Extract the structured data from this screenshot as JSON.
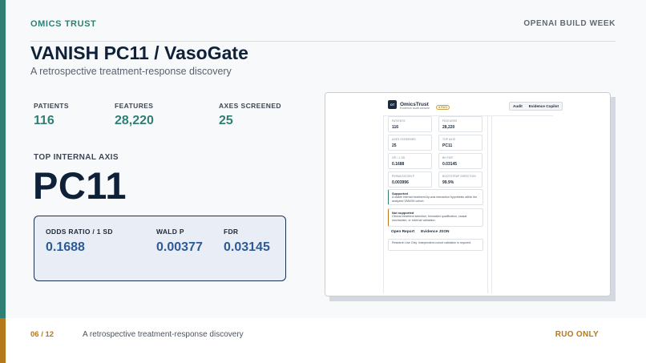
{
  "colors": {
    "teal": "#2f7f74",
    "amber": "#b5781a",
    "navy": "#0e2139",
    "blue": "#2d5a96"
  },
  "header": {
    "brand": "OMICS TRUST",
    "event": "OPENAI BUILD WEEK"
  },
  "title": "VANISH PC11 / VasoGate",
  "subtitle": "A retrospective treatment-response discovery",
  "metrics": [
    {
      "label": "PATIENTS",
      "value": "116"
    },
    {
      "label": "FEATURES",
      "value": "28,220"
    },
    {
      "label": "AXES SCREENED",
      "value": "25"
    }
  ],
  "top_axis": {
    "label": "TOP INTERNAL AXIS",
    "value": "PC11"
  },
  "stats": [
    {
      "label": "ODDS RATIO / 1 SD",
      "value": "0.1688"
    },
    {
      "label": "WALD P",
      "value": "0.00377"
    },
    {
      "label": "FDR",
      "value": "0.03145"
    }
  ],
  "screenshot": {
    "app_name": "OmicsTrust",
    "app_sub": "Evidence audit console",
    "badge": "RUO",
    "logo": "OT",
    "tabs": [
      "Audit",
      "Evidence Copilot"
    ],
    "cards": [
      {
        "label": "PATIENTS",
        "value": "116"
      },
      {
        "label": "FEATURES",
        "value": "28,220"
      },
      {
        "label": "AXES SCREENED",
        "value": "25"
      },
      {
        "label": "TOP AXIS",
        "value": "PC11"
      },
      {
        "label": "OR / 1 SD",
        "value": "0.1688"
      },
      {
        "label": "BH FDR",
        "value": "0.03145"
      },
      {
        "label": "PERMUTATION P",
        "value": "0.003996"
      },
      {
        "label": "BOOTSTRAP DIRECTION",
        "value": "99.9%"
      }
    ],
    "supported": {
      "title": "Supported",
      "body": "A stable internal treatment-by-axis interaction hypothesis within the analyzed VANISH cohort."
    },
    "not_supported": {
      "title": "Not supported",
      "body": "Clinical treatment selection, biomarker qualification, causal mechanism, or external validation."
    },
    "links": [
      "Open Report",
      "Evidence JSON"
    ],
    "ruo_note": "Research Use Only. Independent-cohort validation is required."
  },
  "footer": {
    "page": "06 / 12",
    "text": "A retrospective treatment-response discovery",
    "ruo": "RUO ONLY"
  }
}
